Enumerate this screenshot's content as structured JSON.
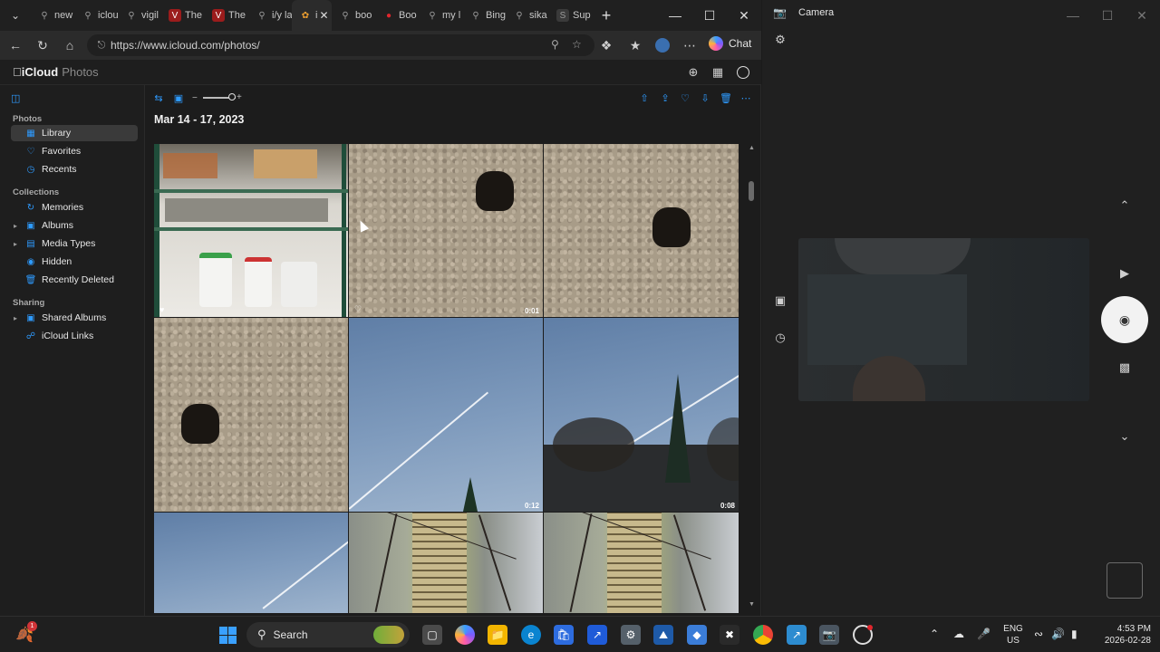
{
  "browser": {
    "tabs": [
      {
        "label": "new",
        "icon": "search-icon"
      },
      {
        "label": "iclou",
        "icon": "search-icon"
      },
      {
        "label": "vigil",
        "icon": "search-icon"
      },
      {
        "label": "The",
        "icon": "v-icon"
      },
      {
        "label": "The",
        "icon": "v-icon"
      },
      {
        "label": "i/y la",
        "icon": "search-icon"
      },
      {
        "label": "i",
        "icon": "icloud-photos-icon",
        "active": true
      },
      {
        "label": "boo",
        "icon": "search-icon"
      },
      {
        "label": "Boo",
        "icon": "record-icon"
      },
      {
        "label": "my l",
        "icon": "search-icon"
      },
      {
        "label": "Bing",
        "icon": "search-icon"
      },
      {
        "label": "sika",
        "icon": "search-icon"
      },
      {
        "label": "Sup",
        "icon": "s-icon"
      }
    ],
    "url": "https://www.icloud.com/photos/",
    "chat_label": "Chat"
  },
  "icloud": {
    "brand": "iCloud",
    "app": "Photos"
  },
  "sidebar": {
    "photos_head": "Photos",
    "photos_items": [
      {
        "label": "Library",
        "icon": "library-icon",
        "selected": true
      },
      {
        "label": "Favorites",
        "icon": "heart-icon"
      },
      {
        "label": "Recents",
        "icon": "clock-icon"
      }
    ],
    "collections_head": "Collections",
    "collections_items": [
      {
        "label": "Memories",
        "icon": "memories-icon",
        "chevron": false
      },
      {
        "label": "Albums",
        "icon": "album-icon",
        "chevron": true
      },
      {
        "label": "Media Types",
        "icon": "media-types-icon",
        "chevron": true
      },
      {
        "label": "Hidden",
        "icon": "eye-icon",
        "chevron": false
      },
      {
        "label": "Recently Deleted",
        "icon": "trash-icon",
        "chevron": false
      }
    ],
    "sharing_head": "Sharing",
    "sharing_items": [
      {
        "label": "Shared Albums",
        "icon": "shared-album-icon",
        "chevron": true
      },
      {
        "label": "iCloud Links",
        "icon": "link-icon",
        "chevron": false
      }
    ]
  },
  "library": {
    "date_range": "Mar 14 - 17, 2023",
    "tiles": [
      {
        "kind": "shelf",
        "favorite": true,
        "duration": ""
      },
      {
        "kind": "stucco",
        "favorite": true,
        "duration": "0:01"
      },
      {
        "kind": "stucco",
        "favorite": false,
        "duration": ""
      },
      {
        "kind": "stucco",
        "favorite": false,
        "duration": ""
      },
      {
        "kind": "sky",
        "favorite": false,
        "duration": "0:12"
      },
      {
        "kind": "sky-trees",
        "favorite": false,
        "duration": "0:08"
      },
      {
        "kind": "sky",
        "favorite": false,
        "duration": ""
      },
      {
        "kind": "branches",
        "favorite": false,
        "duration": ""
      },
      {
        "kind": "branches",
        "favorite": false,
        "duration": ""
      }
    ]
  },
  "camera": {
    "title": "Camera"
  },
  "taskbar": {
    "search_label": "Search",
    "lang_top": "ENG",
    "lang_bottom": "US",
    "time": "4:53 PM",
    "date": "2026-02-28",
    "notification_count": "1"
  },
  "colors": {
    "accent": "#2e9bff",
    "sidebar_selected": "#3a3a3a"
  }
}
